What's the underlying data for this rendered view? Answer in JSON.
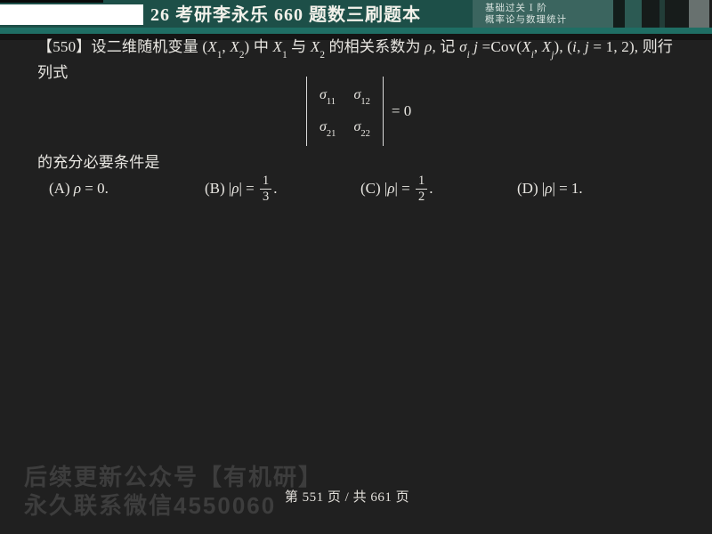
{
  "header": {
    "title": "26 考研李永乐 660 题数三刷题本",
    "stage_line1": "基础过关 Ⅰ 阶",
    "stage_line2": "概率论与数理统计",
    "colors": {
      "bar_teal": "#1d4f48",
      "accent_teal": "#1f6e64",
      "info_box_teal": "#3b655f",
      "white_box": "#ffffff"
    }
  },
  "problem": {
    "number": "【550】",
    "line1_segments": [
      [
        "n",
        "【550】设二维随机变量 ("
      ],
      [
        "i",
        "X"
      ],
      [
        "sub",
        "1"
      ],
      [
        "n",
        ", "
      ],
      [
        "i",
        "X"
      ],
      [
        "sub",
        "2"
      ],
      [
        "n",
        ") 中 "
      ],
      [
        "i",
        "X"
      ],
      [
        "sub",
        "1"
      ],
      [
        "n",
        " 与 "
      ],
      [
        "i",
        "X"
      ],
      [
        "sub",
        "2"
      ],
      [
        "n",
        " 的相关系数为 "
      ],
      [
        "i",
        "ρ"
      ],
      [
        "n",
        ", 记 "
      ],
      [
        "i",
        "σ"
      ],
      [
        "isub",
        "i"
      ],
      [
        "i",
        " j"
      ],
      [
        "n",
        " =Cov("
      ],
      [
        "i",
        "X"
      ],
      [
        "isub",
        "i"
      ],
      [
        "n",
        ", "
      ],
      [
        "i",
        "X"
      ],
      [
        "isub",
        "j"
      ],
      [
        "n",
        "), ("
      ],
      [
        "i",
        "i"
      ],
      [
        "n",
        ", "
      ],
      [
        "i",
        "j"
      ],
      [
        "n",
        " = 1, 2), 则行"
      ]
    ],
    "line2": "列式",
    "determinant": {
      "cells": [
        [
          [
            "i",
            "σ"
          ],
          [
            "sub",
            "11"
          ]
        ],
        [
          [
            "i",
            "σ"
          ],
          [
            "sub",
            "12"
          ]
        ],
        [
          [
            "i",
            "σ"
          ],
          [
            "sub",
            "21"
          ]
        ],
        [
          [
            "i",
            "σ"
          ],
          [
            "sub",
            "22"
          ]
        ]
      ],
      "equals_segments": [
        [
          "n",
          "= 0"
        ]
      ]
    },
    "condition": "的充分必要条件是",
    "options": [
      {
        "label": "A",
        "segments": [
          [
            "n",
            "(A) "
          ],
          [
            "i",
            "ρ"
          ],
          [
            "n",
            " = 0."
          ]
        ]
      },
      {
        "label": "B",
        "segments": [
          [
            "n",
            "(B) |"
          ],
          [
            "i",
            "ρ"
          ],
          [
            "n",
            "| = "
          ],
          [
            "frac",
            "1/3"
          ],
          [
            "n",
            "."
          ]
        ]
      },
      {
        "label": "C",
        "segments": [
          [
            "n",
            "(C) |"
          ],
          [
            "i",
            "ρ"
          ],
          [
            "n",
            "| = "
          ],
          [
            "frac",
            "1/2"
          ],
          [
            "n",
            "."
          ]
        ]
      },
      {
        "label": "D",
        "segments": [
          [
            "n",
            "(D) |"
          ],
          [
            "i",
            "ρ"
          ],
          [
            "n",
            "| = 1."
          ]
        ]
      }
    ]
  },
  "footer": {
    "watermark_line1": "后续更新公众号【有机研】",
    "watermark_line2": "永久联系微信4550060",
    "page_indicator": "第 551 页 / 共 661 页"
  }
}
